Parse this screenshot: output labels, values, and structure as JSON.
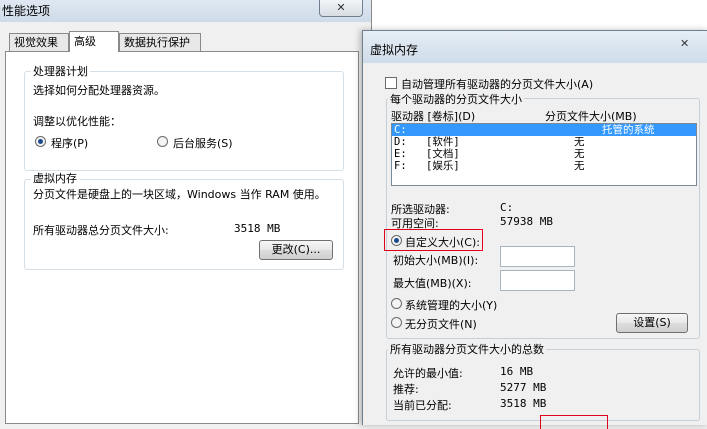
{
  "perf_window": {
    "title": "性能选项",
    "tabs": [
      {
        "label": "视觉效果",
        "active": false
      },
      {
        "label": "高级",
        "active": true
      },
      {
        "label": "数据执行保护",
        "active": false
      }
    ],
    "processor_group": {
      "title": "处理器计划",
      "description": "选择如何分配处理器资源。",
      "adjust_label": "调整以优化性能：",
      "options": [
        {
          "label": "程序(P)",
          "checked": true
        },
        {
          "label": "后台服务(S)",
          "checked": false
        }
      ]
    },
    "vm_group": {
      "title": "虚拟内存",
      "description": "分页文件是硬盘上的一块区域，Windows 当作 RAM 使用。",
      "total_label": "所有驱动器总分页文件大小:",
      "total_value": "3518 MB",
      "change_button": "更改(C)..."
    }
  },
  "vm_dialog": {
    "title": "虚拟内存",
    "close_glyph": "✕",
    "auto_manage": {
      "label": "自动管理所有驱动器的分页文件大小(A)",
      "checked": false
    },
    "per_drive_group": {
      "title": "每个驱动器的分页文件大小",
      "col_drive": "驱动器 [卷标](D)",
      "col_size": "分页文件大小(MB)",
      "drives": [
        {
          "drive": "C:",
          "label": "",
          "size": "托管的系统",
          "selected": true
        },
        {
          "drive": "D:",
          "label": "[软件]",
          "size": "无",
          "selected": false
        },
        {
          "drive": "E:",
          "label": "[文档]",
          "size": "无",
          "selected": false
        },
        {
          "drive": "F:",
          "label": "[娱乐]",
          "size": "无",
          "selected": false
        }
      ],
      "selected_drive_label": "所选驱动器:",
      "selected_drive_value": "C:",
      "free_space_label": "可用空间:",
      "free_space_value": "57938 MB",
      "custom_size": {
        "label": "自定义大小(C):",
        "checked": true
      },
      "initial_size_label": "初始大小(MB)(I):",
      "initial_size_value": "",
      "max_size_label": "最大值(MB)(X):",
      "max_size_value": "",
      "system_managed": {
        "label": "系统管理的大小(Y)",
        "checked": false
      },
      "no_paging": {
        "label": "无分页文件(N)",
        "checked": false
      },
      "set_button": "设置(S)"
    },
    "total_group": {
      "title": "所有驱动器分页文件大小的总数",
      "min_label": "允许的最小值:",
      "min_value": "16 MB",
      "recommended_label": "推荐:",
      "recommended_value": "5277 MB",
      "current_label": "当前已分配:",
      "current_value": "3518 MB"
    }
  },
  "colors": {
    "selection": "#3399ff",
    "highlight_box": "#e0001b",
    "window_bg": "#f0f0f0"
  }
}
